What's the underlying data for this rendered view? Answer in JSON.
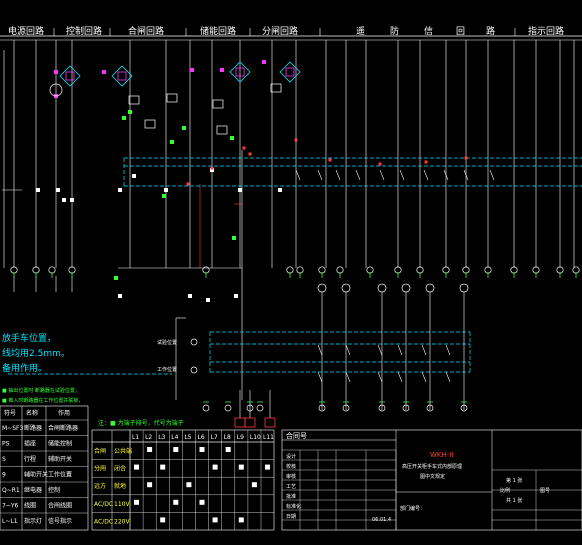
{
  "header": {
    "sections": [
      "电源回路",
      "控制回路",
      "合闸回路",
      "储能回路",
      "分闸回路",
      "遥",
      "防",
      "信",
      "回",
      "路",
      "指示回路"
    ]
  },
  "notes": {
    "line1": "放手车位置，",
    "line2": "线均用2.5mm。",
    "line3": "备用作用。",
    "green1": "■ 抽出位置时 断路器在试验位置，",
    "green2": "■ 推入时断路器在工作位置并联锁，"
  },
  "labels": {
    "test_pos": "试验位置",
    "work_pos": "工作位置",
    "scale_note": "注：■ 为端子排号，代号为端子",
    "code": "代号"
  },
  "legend_table": {
    "headers": [
      "符号",
      "名称",
      "作用"
    ],
    "rows": [
      [
        "M~SF3",
        "断路器",
        "合闸断路器"
      ],
      [
        "PS",
        "插座",
        "储能控制"
      ],
      [
        "S",
        "行程",
        "辅助开关"
      ],
      [
        "9",
        "辅助开关",
        "工作位置"
      ],
      [
        "Q~R1",
        "继电器",
        "控制"
      ],
      [
        "7~Y6",
        "线圈",
        "合闸线圈"
      ],
      [
        "L~L1",
        "指示灯",
        "信号指示"
      ]
    ]
  },
  "switch_table": {
    "headers": [
      "L1",
      "L2",
      "L3",
      "L4",
      "L5",
      "L6",
      "L7",
      "L8",
      "L9",
      "L10",
      "L11"
    ],
    "row_labels": [
      [
        "合闸",
        "公共端"
      ],
      [
        "分闸",
        "闭合"
      ],
      [
        "远方",
        "就地"
      ],
      [
        "AC/DC",
        "110V"
      ],
      [
        "AC/DC",
        "220V"
      ]
    ]
  },
  "title_block": {
    "contract_label": "合同号",
    "drawing_title_red": "WKH-II",
    "drawing_title_1": "高压开关柜手车式内部原理",
    "drawing_title_2": "图中文规定",
    "cells": [
      "设计",
      "校核",
      "审核",
      "工艺",
      "批准",
      "标准化",
      "日期"
    ],
    "sheet": "第 1 张",
    "total": "共 1 张",
    "date": "06.01.4",
    "dept": "部门编号：",
    "scale_label": "比例",
    "figure_no": "图号"
  },
  "colors": {
    "wire": "#ffffff",
    "cyan": "#00e5ff",
    "green": "#33ff33",
    "red": "#ff3b3b",
    "yellow": "#ffff33",
    "magenta": "#ff33ff"
  }
}
